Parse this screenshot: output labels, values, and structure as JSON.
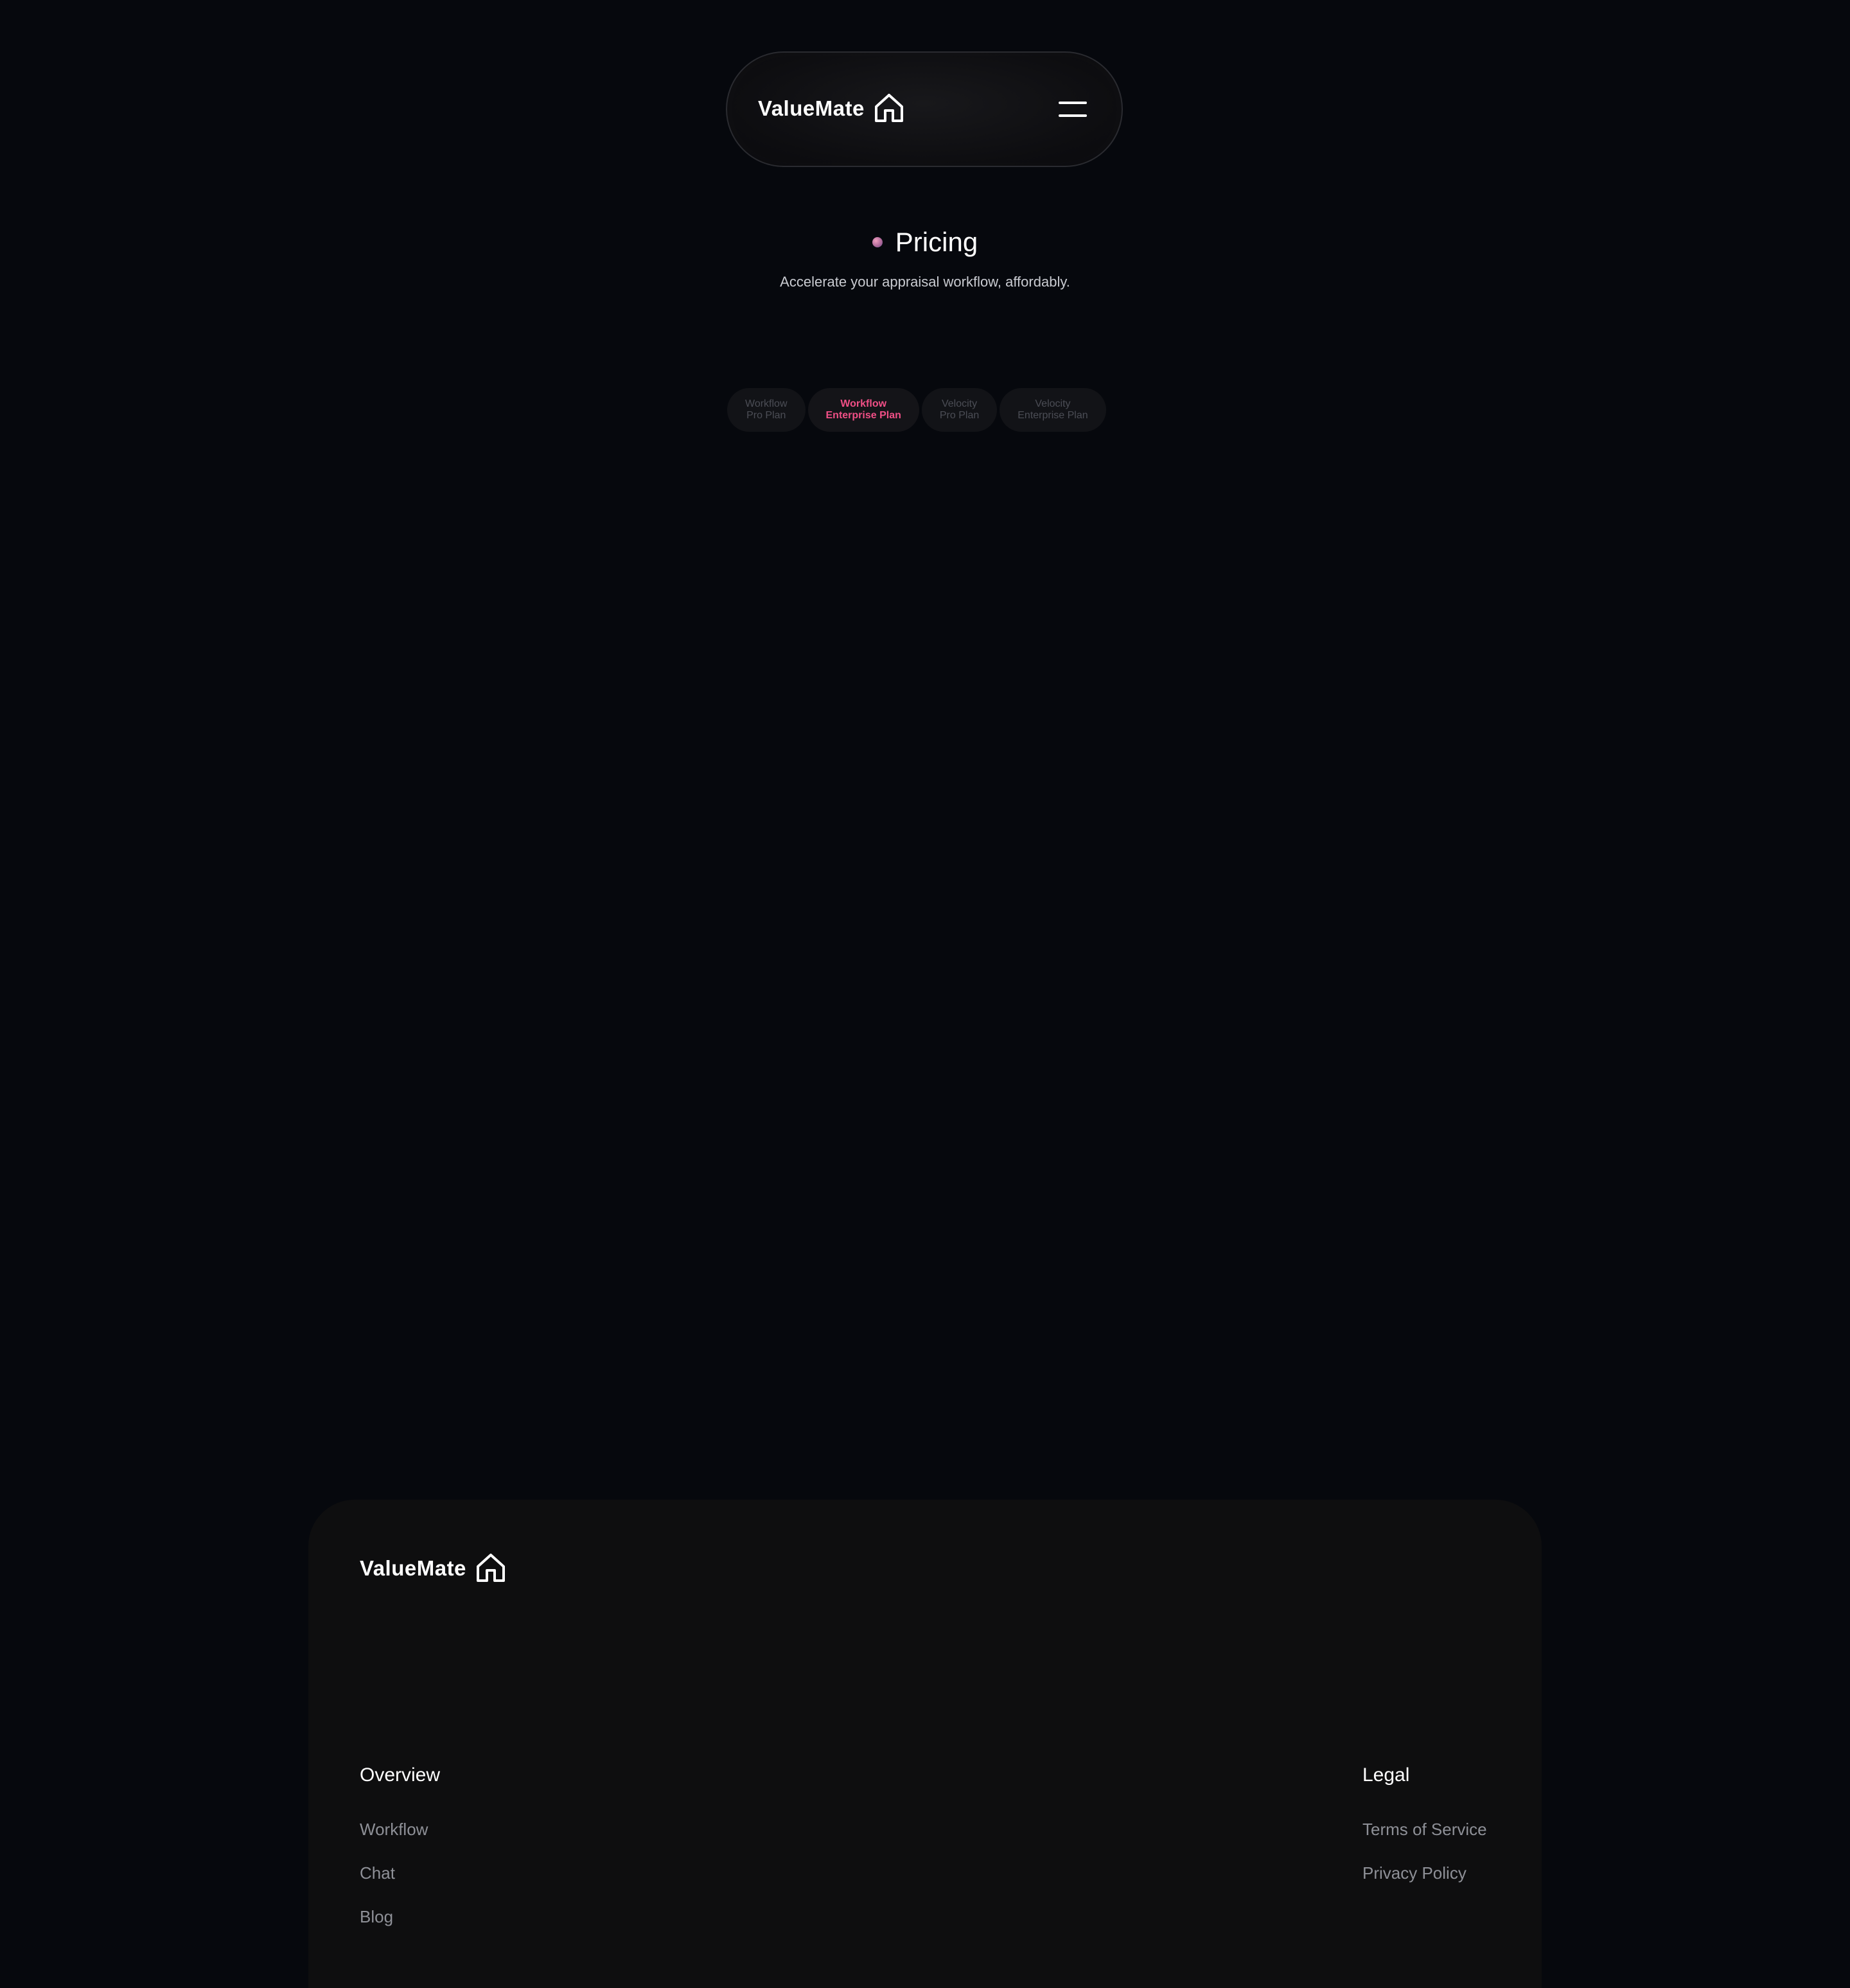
{
  "nav": {
    "brand": "ValueMate",
    "brand_icon": "house-icon",
    "menu_icon": "hamburger-menu-icon"
  },
  "pricing": {
    "title": "Pricing",
    "subtitle": "Accelerate your appraisal workflow, affordably."
  },
  "plan_tabs": [
    {
      "line1": "Workflow",
      "line2": "Pro Plan",
      "active": false
    },
    {
      "line1": "Workflow",
      "line2": "Enterprise Plan",
      "active": true
    },
    {
      "line1": "Velocity",
      "line2": "Pro Plan",
      "active": false
    },
    {
      "line1": "Velocity",
      "line2": "Enterprise Plan",
      "active": false
    }
  ],
  "footer": {
    "brand": "ValueMate",
    "brand_icon": "house-icon",
    "overview": {
      "title": "Overview",
      "links": [
        "Workflow",
        "Chat",
        "Blog"
      ]
    },
    "legal": {
      "title": "Legal",
      "links": [
        "Terms of Service",
        "Privacy Policy"
      ]
    }
  },
  "colors": {
    "background": "#06080d",
    "accent": "#f04f86",
    "footer_bg": "#0e0e0f",
    "muted_text": "#8e9097"
  }
}
